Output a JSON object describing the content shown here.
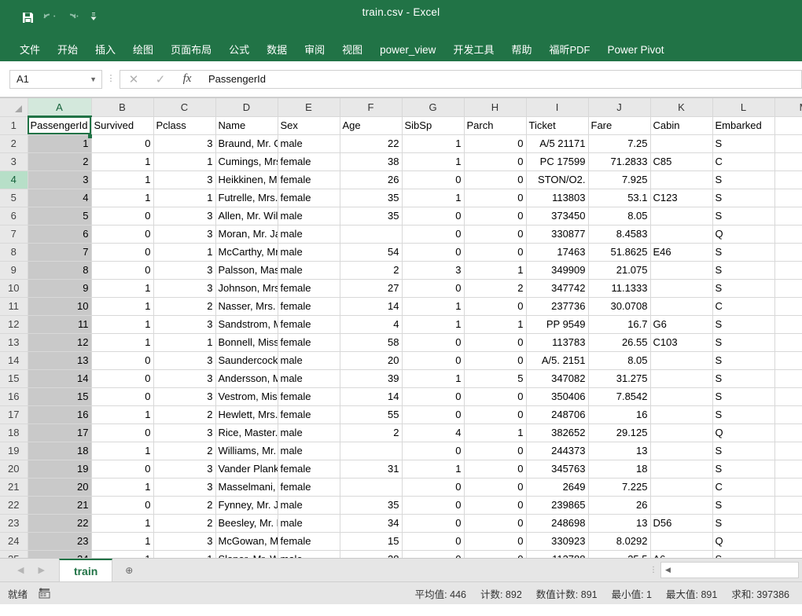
{
  "window": {
    "title": "train.csv  -  Excel",
    "quick_access": [
      {
        "name": "save-icon",
        "label": "保存"
      },
      {
        "name": "undo-icon",
        "label": "撤消"
      },
      {
        "name": "redo-icon",
        "label": "恢复"
      },
      {
        "name": "customize-quick-access-icon",
        "label": "自定义快速访问工具栏"
      }
    ]
  },
  "ribbon": {
    "tabs": [
      {
        "label": "文件",
        "latin": false
      },
      {
        "label": "开始",
        "latin": false
      },
      {
        "label": "插入",
        "latin": false
      },
      {
        "label": "绘图",
        "latin": false
      },
      {
        "label": "页面布局",
        "latin": false
      },
      {
        "label": "公式",
        "latin": false
      },
      {
        "label": "数据",
        "latin": false
      },
      {
        "label": "审阅",
        "latin": false
      },
      {
        "label": "视图",
        "latin": false
      },
      {
        "label": "power_view",
        "latin": true
      },
      {
        "label": "开发工具",
        "latin": false
      },
      {
        "label": "帮助",
        "latin": false
      },
      {
        "label": "福昕PDF",
        "latin": false
      },
      {
        "label": "Power Pivot",
        "latin": true
      }
    ]
  },
  "formula_bar": {
    "name_box_value": "A1",
    "cancel_label": "✕",
    "enter_label": "✓",
    "fx_label": "fx",
    "formula_value": "PassengerId"
  },
  "grid": {
    "selected_cell": "A1",
    "selected_column": "A",
    "highlighted_row_header": "4",
    "column_headers": [
      "A",
      "B",
      "C",
      "D",
      "E",
      "F",
      "G",
      "H",
      "I",
      "J",
      "K",
      "L",
      "M"
    ],
    "row_numbers": [
      "1",
      "2",
      "3",
      "4",
      "5",
      "6",
      "7",
      "8",
      "9",
      "10",
      "11",
      "12",
      "13",
      "14",
      "15",
      "16",
      "17",
      "18",
      "19",
      "20",
      "21",
      "22",
      "23",
      "24",
      "25"
    ],
    "header_row": [
      "PassengerId",
      "Survived",
      "Pclass",
      "Name",
      "Sex",
      "Age",
      "SibSp",
      "Parch",
      "Ticket",
      "Fare",
      "Cabin",
      "Embarked",
      ""
    ],
    "rows": [
      [
        "1",
        "0",
        "3",
        "Braund, Mr. Owen Harris",
        "male",
        "22",
        "1",
        "0",
        "A/5 21171",
        "7.25",
        "",
        "S",
        ""
      ],
      [
        "2",
        "1",
        "1",
        "Cumings, Mrs. John Bradley",
        "female",
        "38",
        "1",
        "0",
        "PC 17599",
        "71.2833",
        "C85",
        "C",
        ""
      ],
      [
        "3",
        "1",
        "3",
        "Heikkinen, Miss. Laina",
        "female",
        "26",
        "0",
        "0",
        "STON/O2.",
        "7.925",
        "",
        "S",
        ""
      ],
      [
        "4",
        "1",
        "1",
        "Futrelle, Mrs. Jacques Heath",
        "female",
        "35",
        "1",
        "0",
        "113803",
        "53.1",
        "C123",
        "S",
        ""
      ],
      [
        "5",
        "0",
        "3",
        "Allen, Mr. William Henry",
        "male",
        "35",
        "0",
        "0",
        "373450",
        "8.05",
        "",
        "S",
        ""
      ],
      [
        "6",
        "0",
        "3",
        "Moran, Mr. James",
        "male",
        "",
        "0",
        "0",
        "330877",
        "8.4583",
        "",
        "Q",
        ""
      ],
      [
        "7",
        "0",
        "1",
        "McCarthy, Mr. Timothy J",
        "male",
        "54",
        "0",
        "0",
        "17463",
        "51.8625",
        "E46",
        "S",
        ""
      ],
      [
        "8",
        "0",
        "3",
        "Palsson, Master. Gosta",
        "male",
        "2",
        "3",
        "1",
        "349909",
        "21.075",
        "",
        "S",
        ""
      ],
      [
        "9",
        "1",
        "3",
        "Johnson, Mrs. Oscar W",
        "female",
        "27",
        "0",
        "2",
        "347742",
        "11.1333",
        "",
        "S",
        ""
      ],
      [
        "10",
        "1",
        "2",
        "Nasser, Mrs. Nicholas",
        "female",
        "14",
        "1",
        "0",
        "237736",
        "30.0708",
        "",
        "C",
        ""
      ],
      [
        "11",
        "1",
        "3",
        "Sandstrom, Miss. Marguerite",
        "female",
        "4",
        "1",
        "1",
        "PP 9549",
        "16.7",
        "G6",
        "S",
        ""
      ],
      [
        "12",
        "1",
        "1",
        "Bonnell, Miss. Elizabeth",
        "female",
        "58",
        "0",
        "0",
        "113783",
        "26.55",
        "C103",
        "S",
        ""
      ],
      [
        "13",
        "0",
        "3",
        "Saundercock, Mr. William",
        "male",
        "20",
        "0",
        "0",
        "A/5. 2151",
        "8.05",
        "",
        "S",
        ""
      ],
      [
        "14",
        "0",
        "3",
        "Andersson, Mr. Anders",
        "male",
        "39",
        "1",
        "5",
        "347082",
        "31.275",
        "",
        "S",
        ""
      ],
      [
        "15",
        "0",
        "3",
        "Vestrom, Miss. Hulda",
        "female",
        "14",
        "0",
        "0",
        "350406",
        "7.8542",
        "",
        "S",
        ""
      ],
      [
        "16",
        "1",
        "2",
        "Hewlett, Mrs. Mary D",
        "female",
        "55",
        "0",
        "0",
        "248706",
        "16",
        "",
        "S",
        ""
      ],
      [
        "17",
        "0",
        "3",
        "Rice, Master. Eugene",
        "male",
        "2",
        "4",
        "1",
        "382652",
        "29.125",
        "",
        "Q",
        ""
      ],
      [
        "18",
        "1",
        "2",
        "Williams, Mr. Charles",
        "male",
        "",
        "0",
        "0",
        "244373",
        "13",
        "",
        "S",
        ""
      ],
      [
        "19",
        "0",
        "3",
        "Vander Planke, Mrs.",
        "female",
        "31",
        "1",
        "0",
        "345763",
        "18",
        "",
        "S",
        ""
      ],
      [
        "20",
        "1",
        "3",
        "Masselmani, Mrs. Fatima",
        "female",
        "",
        "0",
        "0",
        "2649",
        "7.225",
        "",
        "C",
        ""
      ],
      [
        "21",
        "0",
        "2",
        "Fynney, Mr. Joseph J",
        "male",
        "35",
        "0",
        "0",
        "239865",
        "26",
        "",
        "S",
        ""
      ],
      [
        "22",
        "1",
        "2",
        "Beesley, Mr. Lawrence",
        "male",
        "34",
        "0",
        "0",
        "248698",
        "13",
        "D56",
        "S",
        ""
      ],
      [
        "23",
        "1",
        "3",
        "McGowan, Miss. Anna",
        "female",
        "15",
        "0",
        "0",
        "330923",
        "8.0292",
        "",
        "Q",
        ""
      ],
      [
        "24",
        "1",
        "1",
        "Sloper, Mr. William T",
        "male",
        "28",
        "0",
        "0",
        "113788",
        "35.5",
        "A6",
        "S",
        ""
      ]
    ],
    "column_alignment": [
      "num",
      "num",
      "num",
      "txt",
      "txt",
      "num",
      "num",
      "num",
      "num",
      "num",
      "txt",
      "txt",
      "txt"
    ]
  },
  "sheet_bar": {
    "prev_arrow": "◀",
    "next_arrow": "▶",
    "tabs": [
      {
        "label": "train",
        "active": true
      }
    ],
    "add_sheet_label": "⊕",
    "hscroll_left_arrow": "◀"
  },
  "status_bar": {
    "mode": "就绪",
    "accessibility_icon": "accessibility-checker-icon",
    "stats": [
      {
        "label": "平均值",
        "value": "446"
      },
      {
        "label": "计数",
        "value": "892"
      },
      {
        "label": "数值计数",
        "value": "891"
      },
      {
        "label": "最小值",
        "value": "1"
      },
      {
        "label": "最大值",
        "value": "891"
      },
      {
        "label": "求和",
        "value": "397386"
      }
    ]
  },
  "colors": {
    "brand_green": "#217346",
    "header_gray": "#e8e8e8",
    "selection_gray": "#c9c9c9"
  }
}
